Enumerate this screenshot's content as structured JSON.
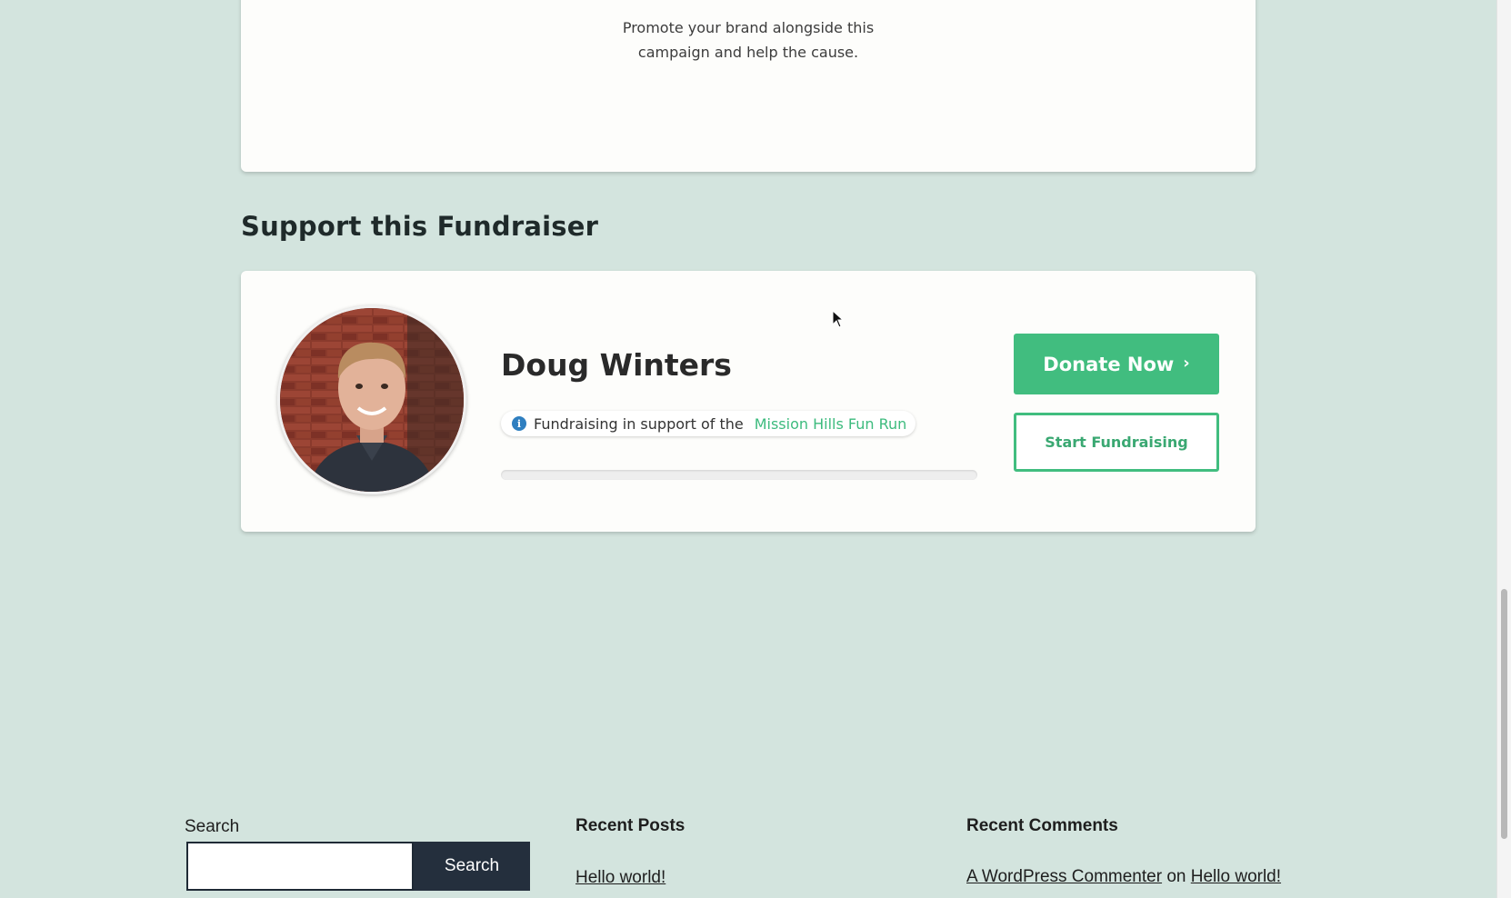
{
  "sponsor": {
    "line1": "Promote your brand alongside this",
    "line2": "campaign and help the cause."
  },
  "section": {
    "heading": "Support this Fundraiser"
  },
  "fundraiser": {
    "name": "Doug Winters",
    "support_prefix": "Fundraising in support of the",
    "campaign_link": "Mission Hills Fun Run",
    "progress_percent": 0,
    "avatar_icon": "avatar-photo",
    "info_icon": "info-icon"
  },
  "actions": {
    "donate_label": "Donate Now",
    "donate_icon": "chevron-right-icon",
    "start_label": "Start Fundraising"
  },
  "footer": {
    "search": {
      "label": "Search",
      "input_value": "",
      "button_label": "Search"
    },
    "recent_posts": {
      "title": "Recent Posts",
      "items": [
        "Hello world!"
      ]
    },
    "recent_comments": {
      "title": "Recent Comments",
      "author": "A WordPress Commenter",
      "connector": "on",
      "post": "Hello world!"
    }
  },
  "colors": {
    "background": "#d3e4de",
    "accent_green": "#41bd7f",
    "link_green": "#3dbb7e",
    "info_blue": "#2f7fc0",
    "footer_button": "#242f3d"
  }
}
